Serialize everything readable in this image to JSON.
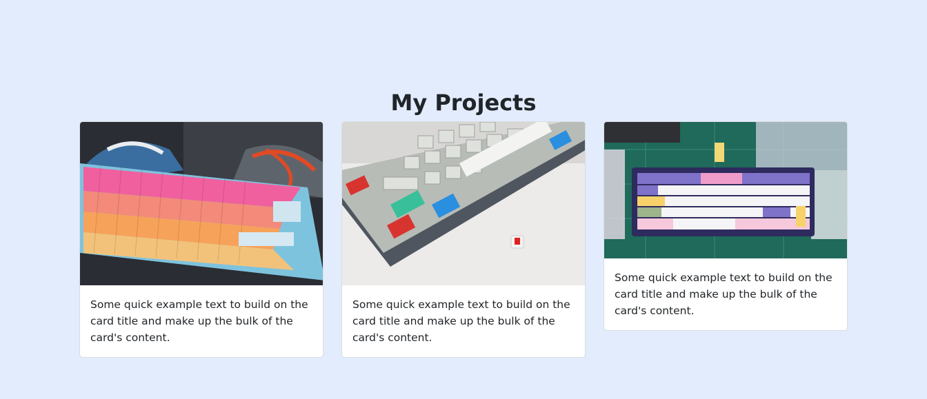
{
  "section": {
    "title": "My Projects"
  },
  "cards": [
    {
      "text": "Some quick example text to build on the card title and make up the bulk of the card's content.",
      "image_alt": "pastel keyboard"
    },
    {
      "text": "Some quick example text to build on the card title and make up the bulk of the card's content.",
      "image_alt": "grey keyboard"
    },
    {
      "text": "Some quick example text to build on the card title and make up the bulk of the card's content.",
      "image_alt": "purple keyboard"
    }
  ],
  "colors": {
    "background": "#e2ecfd",
    "card": "#ffffff",
    "text": "#212529"
  }
}
